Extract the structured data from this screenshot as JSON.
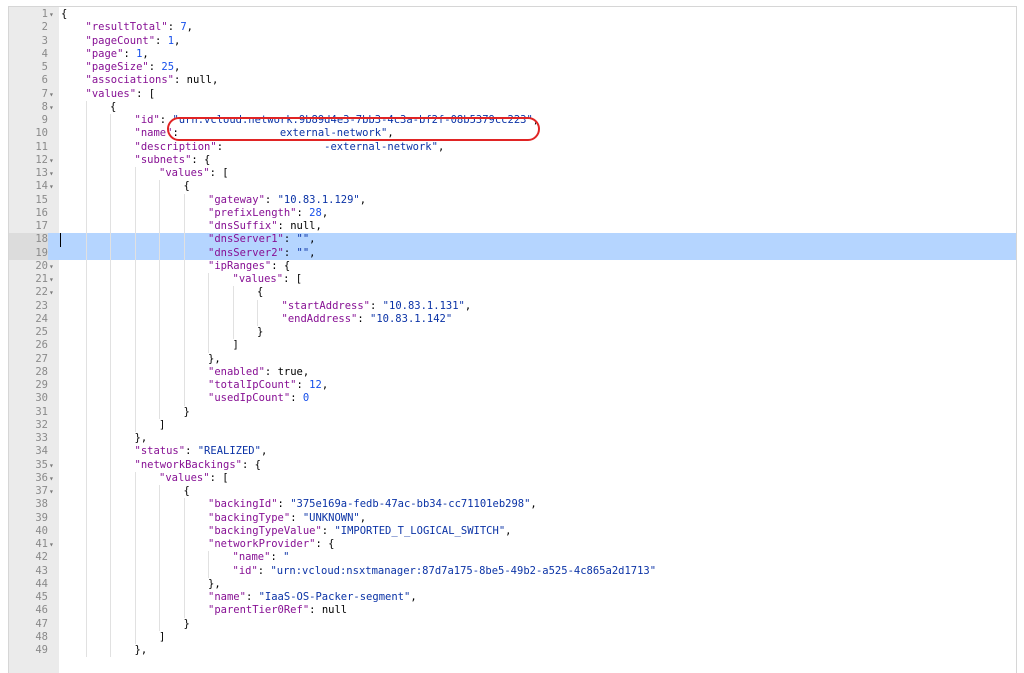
{
  "editor": {
    "highlight_color": "#e02424",
    "selection_color": "#b5d5ff",
    "highlighted_line": 9,
    "selected_lines": [
      18,
      19
    ],
    "cursor_line": 18,
    "lines": [
      {
        "n": "1",
        "fold": true,
        "indent": 0,
        "tokens": [
          {
            "t": "p",
            "v": "{"
          }
        ]
      },
      {
        "n": "2",
        "fold": false,
        "indent": 1,
        "tokens": [
          {
            "t": "k",
            "v": "\"resultTotal\""
          },
          {
            "t": "p",
            "v": ": "
          },
          {
            "t": "n",
            "v": "7"
          },
          {
            "t": "p",
            "v": ","
          }
        ]
      },
      {
        "n": "3",
        "fold": false,
        "indent": 1,
        "tokens": [
          {
            "t": "k",
            "v": "\"pageCount\""
          },
          {
            "t": "p",
            "v": ": "
          },
          {
            "t": "n",
            "v": "1"
          },
          {
            "t": "p",
            "v": ","
          }
        ]
      },
      {
        "n": "4",
        "fold": false,
        "indent": 1,
        "tokens": [
          {
            "t": "k",
            "v": "\"page\""
          },
          {
            "t": "p",
            "v": ": "
          },
          {
            "t": "n",
            "v": "1"
          },
          {
            "t": "p",
            "v": ","
          }
        ]
      },
      {
        "n": "5",
        "fold": false,
        "indent": 1,
        "tokens": [
          {
            "t": "k",
            "v": "\"pageSize\""
          },
          {
            "t": "p",
            "v": ": "
          },
          {
            "t": "n",
            "v": "25"
          },
          {
            "t": "p",
            "v": ","
          }
        ]
      },
      {
        "n": "6",
        "fold": false,
        "indent": 1,
        "tokens": [
          {
            "t": "k",
            "v": "\"associations\""
          },
          {
            "t": "p",
            "v": ": "
          },
          {
            "t": "l",
            "v": "null"
          },
          {
            "t": "p",
            "v": ","
          }
        ]
      },
      {
        "n": "7",
        "fold": true,
        "indent": 1,
        "tokens": [
          {
            "t": "k",
            "v": "\"values\""
          },
          {
            "t": "p",
            "v": ": ["
          }
        ]
      },
      {
        "n": "8",
        "fold": true,
        "indent": 2,
        "tokens": [
          {
            "t": "p",
            "v": "{"
          }
        ]
      },
      {
        "n": "9",
        "fold": false,
        "indent": 3,
        "tokens": [
          {
            "t": "k",
            "v": "\"id\""
          },
          {
            "t": "p",
            "v": ": "
          },
          {
            "t": "s",
            "v": "\"urn:vcloud:network:9b89d4e3-7bb3-4c3a-bf2f-08b5379cc223\""
          },
          {
            "t": "p",
            "v": ","
          }
        ]
      },
      {
        "n": "10",
        "fold": false,
        "indent": 3,
        "tokens": [
          {
            "t": "k",
            "v": "\"name\""
          },
          {
            "t": "p",
            "v": ":                "
          },
          {
            "t": "s",
            "v": "external-network\""
          },
          {
            "t": "p",
            "v": ","
          }
        ]
      },
      {
        "n": "11",
        "fold": false,
        "indent": 3,
        "tokens": [
          {
            "t": "k",
            "v": "\"description\""
          },
          {
            "t": "p",
            "v": ":                "
          },
          {
            "t": "s",
            "v": "-external-network\""
          },
          {
            "t": "p",
            "v": ","
          }
        ]
      },
      {
        "n": "12",
        "fold": true,
        "indent": 3,
        "tokens": [
          {
            "t": "k",
            "v": "\"subnets\""
          },
          {
            "t": "p",
            "v": ": {"
          }
        ]
      },
      {
        "n": "13",
        "fold": true,
        "indent": 4,
        "tokens": [
          {
            "t": "k",
            "v": "\"values\""
          },
          {
            "t": "p",
            "v": ": ["
          }
        ]
      },
      {
        "n": "14",
        "fold": true,
        "indent": 5,
        "tokens": [
          {
            "t": "p",
            "v": "{"
          }
        ]
      },
      {
        "n": "15",
        "fold": false,
        "indent": 6,
        "tokens": [
          {
            "t": "k",
            "v": "\"gateway\""
          },
          {
            "t": "p",
            "v": ": "
          },
          {
            "t": "s",
            "v": "\"10.83.1.129\""
          },
          {
            "t": "p",
            "v": ","
          }
        ]
      },
      {
        "n": "16",
        "fold": false,
        "indent": 6,
        "tokens": [
          {
            "t": "k",
            "v": "\"prefixLength\""
          },
          {
            "t": "p",
            "v": ": "
          },
          {
            "t": "n",
            "v": "28"
          },
          {
            "t": "p",
            "v": ","
          }
        ]
      },
      {
        "n": "17",
        "fold": false,
        "indent": 6,
        "tokens": [
          {
            "t": "k",
            "v": "\"dnsSuffix\""
          },
          {
            "t": "p",
            "v": ": "
          },
          {
            "t": "l",
            "v": "null"
          },
          {
            "t": "p",
            "v": ","
          }
        ]
      },
      {
        "n": "18",
        "fold": false,
        "indent": 6,
        "tokens": [
          {
            "t": "k",
            "v": "\"dnsServer1\""
          },
          {
            "t": "p",
            "v": ": "
          },
          {
            "t": "s",
            "v": "\"\""
          },
          {
            "t": "p",
            "v": ","
          }
        ]
      },
      {
        "n": "19",
        "fold": false,
        "indent": 6,
        "tokens": [
          {
            "t": "k",
            "v": "\"dnsServer2\""
          },
          {
            "t": "p",
            "v": ": "
          },
          {
            "t": "s",
            "v": "\"\""
          },
          {
            "t": "p",
            "v": ","
          }
        ]
      },
      {
        "n": "20",
        "fold": true,
        "indent": 6,
        "tokens": [
          {
            "t": "k",
            "v": "\"ipRanges\""
          },
          {
            "t": "p",
            "v": ": {"
          }
        ]
      },
      {
        "n": "21",
        "fold": true,
        "indent": 7,
        "tokens": [
          {
            "t": "k",
            "v": "\"values\""
          },
          {
            "t": "p",
            "v": ": ["
          }
        ]
      },
      {
        "n": "22",
        "fold": true,
        "indent": 8,
        "tokens": [
          {
            "t": "p",
            "v": "{"
          }
        ]
      },
      {
        "n": "23",
        "fold": false,
        "indent": 9,
        "tokens": [
          {
            "t": "k",
            "v": "\"startAddress\""
          },
          {
            "t": "p",
            "v": ": "
          },
          {
            "t": "s",
            "v": "\"10.83.1.131\""
          },
          {
            "t": "p",
            "v": ","
          }
        ]
      },
      {
        "n": "24",
        "fold": false,
        "indent": 9,
        "tokens": [
          {
            "t": "k",
            "v": "\"endAddress\""
          },
          {
            "t": "p",
            "v": ": "
          },
          {
            "t": "s",
            "v": "\"10.83.1.142\""
          }
        ]
      },
      {
        "n": "25",
        "fold": false,
        "indent": 8,
        "tokens": [
          {
            "t": "p",
            "v": "}"
          }
        ]
      },
      {
        "n": "26",
        "fold": false,
        "indent": 7,
        "tokens": [
          {
            "t": "p",
            "v": "]"
          }
        ]
      },
      {
        "n": "27",
        "fold": false,
        "indent": 6,
        "tokens": [
          {
            "t": "p",
            "v": "},"
          }
        ]
      },
      {
        "n": "28",
        "fold": false,
        "indent": 6,
        "tokens": [
          {
            "t": "k",
            "v": "\"enabled\""
          },
          {
            "t": "p",
            "v": ": "
          },
          {
            "t": "l",
            "v": "true"
          },
          {
            "t": "p",
            "v": ","
          }
        ]
      },
      {
        "n": "29",
        "fold": false,
        "indent": 6,
        "tokens": [
          {
            "t": "k",
            "v": "\"totalIpCount\""
          },
          {
            "t": "p",
            "v": ": "
          },
          {
            "t": "n",
            "v": "12"
          },
          {
            "t": "p",
            "v": ","
          }
        ]
      },
      {
        "n": "30",
        "fold": false,
        "indent": 6,
        "tokens": [
          {
            "t": "k",
            "v": "\"usedIpCount\""
          },
          {
            "t": "p",
            "v": ": "
          },
          {
            "t": "n",
            "v": "0"
          }
        ]
      },
      {
        "n": "31",
        "fold": false,
        "indent": 5,
        "tokens": [
          {
            "t": "p",
            "v": "}"
          }
        ]
      },
      {
        "n": "32",
        "fold": false,
        "indent": 4,
        "tokens": [
          {
            "t": "p",
            "v": "]"
          }
        ]
      },
      {
        "n": "33",
        "fold": false,
        "indent": 3,
        "tokens": [
          {
            "t": "p",
            "v": "},"
          }
        ]
      },
      {
        "n": "34",
        "fold": false,
        "indent": 3,
        "tokens": [
          {
            "t": "k",
            "v": "\"status\""
          },
          {
            "t": "p",
            "v": ": "
          },
          {
            "t": "s",
            "v": "\"REALIZED\""
          },
          {
            "t": "p",
            "v": ","
          }
        ]
      },
      {
        "n": "35",
        "fold": true,
        "indent": 3,
        "tokens": [
          {
            "t": "k",
            "v": "\"networkBackings\""
          },
          {
            "t": "p",
            "v": ": {"
          }
        ]
      },
      {
        "n": "36",
        "fold": true,
        "indent": 4,
        "tokens": [
          {
            "t": "k",
            "v": "\"values\""
          },
          {
            "t": "p",
            "v": ": ["
          }
        ]
      },
      {
        "n": "37",
        "fold": true,
        "indent": 5,
        "tokens": [
          {
            "t": "p",
            "v": "{"
          }
        ]
      },
      {
        "n": "38",
        "fold": false,
        "indent": 6,
        "tokens": [
          {
            "t": "k",
            "v": "\"backingId\""
          },
          {
            "t": "p",
            "v": ": "
          },
          {
            "t": "s",
            "v": "\"375e169a-fedb-47ac-bb34-cc71101eb298\""
          },
          {
            "t": "p",
            "v": ","
          }
        ]
      },
      {
        "n": "39",
        "fold": false,
        "indent": 6,
        "tokens": [
          {
            "t": "k",
            "v": "\"backingType\""
          },
          {
            "t": "p",
            "v": ": "
          },
          {
            "t": "s",
            "v": "\"UNKNOWN\""
          },
          {
            "t": "p",
            "v": ","
          }
        ]
      },
      {
        "n": "40",
        "fold": false,
        "indent": 6,
        "tokens": [
          {
            "t": "k",
            "v": "\"backingTypeValue\""
          },
          {
            "t": "p",
            "v": ": "
          },
          {
            "t": "s",
            "v": "\"IMPORTED_T_LOGICAL_SWITCH\""
          },
          {
            "t": "p",
            "v": ","
          }
        ]
      },
      {
        "n": "41",
        "fold": true,
        "indent": 6,
        "tokens": [
          {
            "t": "k",
            "v": "\"networkProvider\""
          },
          {
            "t": "p",
            "v": ": {"
          }
        ]
      },
      {
        "n": "42",
        "fold": false,
        "indent": 7,
        "tokens": [
          {
            "t": "k",
            "v": "\"name\""
          },
          {
            "t": "p",
            "v": ": "
          },
          {
            "t": "s",
            "v": "\""
          }
        ]
      },
      {
        "n": "43",
        "fold": false,
        "indent": 7,
        "tokens": [
          {
            "t": "k",
            "v": "\"id\""
          },
          {
            "t": "p",
            "v": ": "
          },
          {
            "t": "s",
            "v": "\"urn:vcloud:nsxtmanager:87d7a175-8be5-49b2-a525-4c865a2d1713\""
          }
        ]
      },
      {
        "n": "44",
        "fold": false,
        "indent": 6,
        "tokens": [
          {
            "t": "p",
            "v": "},"
          }
        ]
      },
      {
        "n": "45",
        "fold": false,
        "indent": 6,
        "tokens": [
          {
            "t": "k",
            "v": "\"name\""
          },
          {
            "t": "p",
            "v": ": "
          },
          {
            "t": "s",
            "v": "\"IaaS-OS-Packer-segment\""
          },
          {
            "t": "p",
            "v": ","
          }
        ]
      },
      {
        "n": "46",
        "fold": false,
        "indent": 6,
        "tokens": [
          {
            "t": "k",
            "v": "\"parentTier0Ref\""
          },
          {
            "t": "p",
            "v": ": "
          },
          {
            "t": "l",
            "v": "null"
          }
        ]
      },
      {
        "n": "47",
        "fold": false,
        "indent": 5,
        "tokens": [
          {
            "t": "p",
            "v": "}"
          }
        ]
      },
      {
        "n": "48",
        "fold": false,
        "indent": 4,
        "tokens": [
          {
            "t": "p",
            "v": "]"
          }
        ]
      },
      {
        "n": "49",
        "fold": false,
        "indent": 3,
        "tokens": [
          {
            "t": "p",
            "v": "},"
          }
        ]
      }
    ]
  }
}
